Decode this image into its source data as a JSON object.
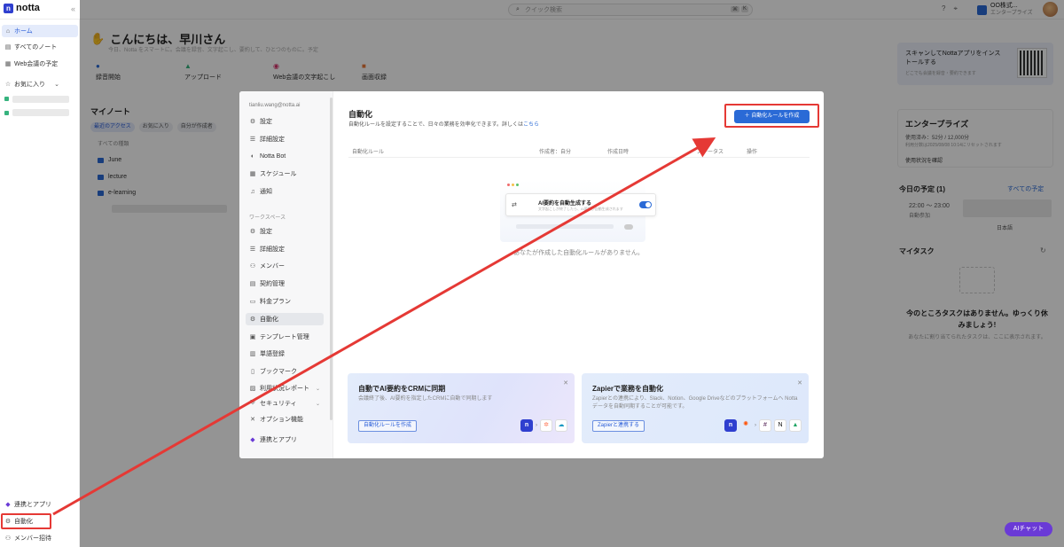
{
  "header": {
    "logo_letter": "n",
    "logo_text": "notta",
    "collapse_icon": "«",
    "search_placeholder": "クイック検索",
    "shortcut_keys": [
      "⌘",
      "K"
    ],
    "account_name": "OO株式...",
    "account_plan": "エンタープライズ"
  },
  "sidebar": {
    "items": [
      {
        "label": "ホーム",
        "icon": "home-icon"
      },
      {
        "label": "すべてのノート",
        "icon": "notes-icon"
      },
      {
        "label": "Web会議の予定",
        "icon": "calendar-icon"
      },
      {
        "label": "お気に入り",
        "icon": "star-icon"
      }
    ],
    "bottom": [
      {
        "label": "連携とアプリ",
        "icon": "apps-icon"
      },
      {
        "label": "自動化",
        "icon": "automation-icon"
      },
      {
        "label": "メンバー招待",
        "icon": "invite-icon"
      }
    ]
  },
  "home": {
    "greeting": "こんにちは、早川さん",
    "greeting_sub": "今日、Notta をスマートに。会議を録音、文字起こし、要約して、ひとつのものに。予定",
    "quick_actions": [
      "録音開始",
      "アップロード",
      "Web会議の文字起こし",
      "画面収録"
    ],
    "my_notes": "マイノート",
    "chips": [
      "最近のアクセス",
      "お気に入り",
      "自分が作成者"
    ],
    "filter": "すべての種類",
    "folders": [
      "June",
      "lecture",
      "e-learning"
    ]
  },
  "right_panel": {
    "promo_text": "スキャンしてNottaアプリをインストールする",
    "promo_sub": "どこでも会議を録音・要約できます",
    "plan_title": "エンタープライズ",
    "usage": "使用済み：52分 / 12,000分",
    "reset": "利用分数は2025/08/08 10:14にリセットされます",
    "usage_link": "使用状況を確認",
    "schedule_title": "今日の予定 (1)",
    "schedule_all": "すべての予定",
    "event_time": "22:00 ～ 23:00",
    "event_auto": "自動参加",
    "event_lang": "日本語",
    "task_title": "マイタスク",
    "task_empty": "今のところタスクはありません。ゆっくり休みましょう!",
    "task_sub": "あなたに割り当てられたタスクは、ここに表示されます。",
    "ai_chat": "AIチャット"
  },
  "modal": {
    "email": "tianliu.wang@notta.ai",
    "personal_items": [
      {
        "label": "設定",
        "icon": "settings-icon"
      },
      {
        "label": "詳細設定",
        "icon": "advanced-settings-icon"
      },
      {
        "label": "Notta Bot",
        "icon": "bot-icon"
      },
      {
        "label": "スケジュール",
        "icon": "calendar-icon"
      },
      {
        "label": "通知",
        "icon": "bell-icon"
      }
    ],
    "workspace_label": "ワークスペース",
    "workspace_items": [
      {
        "label": "設定",
        "icon": "settings-icon"
      },
      {
        "label": "詳細設定",
        "icon": "advanced-settings-icon"
      },
      {
        "label": "メンバー",
        "icon": "members-icon"
      },
      {
        "label": "契約管理",
        "icon": "contract-icon"
      },
      {
        "label": "料金プラン",
        "icon": "pricing-icon"
      },
      {
        "label": "自動化",
        "icon": "automation-icon"
      },
      {
        "label": "テンプレート管理",
        "icon": "template-icon"
      },
      {
        "label": "単語登録",
        "icon": "dictionary-icon"
      },
      {
        "label": "ブックマーク",
        "icon": "bookmark-icon"
      },
      {
        "label": "利用状況レポート",
        "icon": "report-icon"
      },
      {
        "label": "セキュリティ",
        "icon": "security-icon"
      },
      {
        "label": "オプション機能",
        "icon": "options-icon"
      },
      {
        "label": "連携とアプリ",
        "icon": "apps-icon"
      }
    ],
    "title": "自動化",
    "description": "自動化ルールを設定することで、日々の業務を効率化できます。詳しくは",
    "description_link": "こちら",
    "create_button": "＋ 自動化ルールを作成",
    "table_headers": [
      "自動化ルール",
      "作成者：自分",
      "作成日時",
      "ステータス",
      "操作"
    ],
    "illustration_title": "AI要約を自動生成する",
    "illustration_sub": "文字起こしが終了したら、AI要約が自動生成されます",
    "empty_text": "あなたが作成した自動化ルールがありません。",
    "cards": [
      {
        "title": "自動でAI要約をCRMに同期",
        "desc": "会議終了後、AI要約を指定したCRMに自動で同期します",
        "button": "自動化ルールを作成"
      },
      {
        "title": "Zapierで業務を自動化",
        "desc": "Zapierとの連携により、Slack、Notion、Google Driveなどのプラットフォームへ Nottaデータを自動同期することが可能です。",
        "button": "Zapierと連携する"
      }
    ]
  },
  "colors": {
    "brand": "#2f3fcf",
    "accent": "#2a6ad6",
    "annotation_red": "#e53935",
    "ai_chat": "#6a3ad6"
  }
}
